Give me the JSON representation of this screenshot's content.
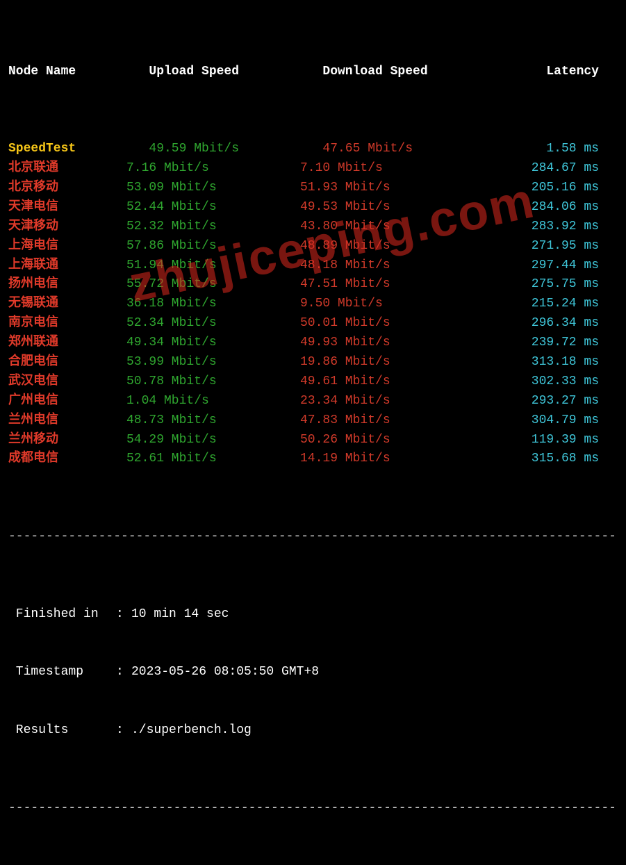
{
  "headers": {
    "node": "Node Name",
    "upload": "Upload Speed",
    "download": "Download Speed",
    "latency": "Latency"
  },
  "rows": [
    {
      "node": "SpeedTest",
      "node_class": "yellow",
      "upload": "49.59 Mbit/s",
      "up_pad": "   ",
      "download": "47.65 Mbit/s",
      "dn_pad": "   ",
      "latency": "1.58 ms",
      "first": true
    },
    {
      "node": "北京联通",
      "node_class": "redb",
      "upload": "7.16 Mbit/s",
      "up_pad": "",
      "download": "7.10 Mbit/s",
      "dn_pad": "",
      "latency": "284.67 ms"
    },
    {
      "node": "北京移动",
      "node_class": "redb",
      "upload": "53.09 Mbit/s",
      "up_pad": "",
      "download": "51.93 Mbit/s",
      "dn_pad": "",
      "latency": "205.16 ms"
    },
    {
      "node": "天津电信",
      "node_class": "redb",
      "upload": "52.44 Mbit/s",
      "up_pad": "",
      "download": "49.53 Mbit/s",
      "dn_pad": "",
      "latency": "284.06 ms"
    },
    {
      "node": "天津移动",
      "node_class": "redb",
      "upload": "52.32 Mbit/s",
      "up_pad": "",
      "download": "43.80 Mbit/s",
      "dn_pad": "",
      "latency": "283.92 ms"
    },
    {
      "node": "上海电信",
      "node_class": "redb",
      "upload": "57.86 Mbit/s",
      "up_pad": "",
      "download": "48.89 Mbit/s",
      "dn_pad": "",
      "latency": "271.95 ms"
    },
    {
      "node": "上海联通",
      "node_class": "redb",
      "upload": "51.94 Mbit/s",
      "up_pad": "",
      "download": "48.18 Mbit/s",
      "dn_pad": "",
      "latency": "297.44 ms"
    },
    {
      "node": "扬州电信",
      "node_class": "redb",
      "upload": "55.72 Mbit/s",
      "up_pad": "",
      "download": "47.51 Mbit/s",
      "dn_pad": "",
      "latency": "275.75 ms"
    },
    {
      "node": "无锡联通",
      "node_class": "redb",
      "upload": "36.18 Mbit/s",
      "up_pad": "",
      "download": "9.50 Mbit/s",
      "dn_pad": "",
      "latency": "215.24 ms"
    },
    {
      "node": "南京电信",
      "node_class": "redb",
      "upload": "52.34 Mbit/s",
      "up_pad": "",
      "download": "50.01 Mbit/s",
      "dn_pad": "",
      "latency": "296.34 ms"
    },
    {
      "node": "郑州联通",
      "node_class": "redb",
      "upload": "49.34 Mbit/s",
      "up_pad": "",
      "download": "49.93 Mbit/s",
      "dn_pad": "",
      "latency": "239.72 ms"
    },
    {
      "node": "合肥电信",
      "node_class": "redb",
      "upload": "53.99 Mbit/s",
      "up_pad": "",
      "download": "19.86 Mbit/s",
      "dn_pad": "",
      "latency": "313.18 ms"
    },
    {
      "node": "武汉电信",
      "node_class": "redb",
      "upload": "50.78 Mbit/s",
      "up_pad": "",
      "download": "49.61 Mbit/s",
      "dn_pad": "",
      "latency": "302.33 ms"
    },
    {
      "node": "广州电信",
      "node_class": "redb",
      "upload": "1.04 Mbit/s",
      "up_pad": "",
      "download": "23.34 Mbit/s",
      "dn_pad": "",
      "latency": "293.27 ms"
    },
    {
      "node": "兰州电信",
      "node_class": "redb",
      "upload": "48.73 Mbit/s",
      "up_pad": "",
      "download": "47.83 Mbit/s",
      "dn_pad": "",
      "latency": "304.79 ms"
    },
    {
      "node": "兰州移动",
      "node_class": "redb",
      "upload": "54.29 Mbit/s",
      "up_pad": "",
      "download": "50.26 Mbit/s",
      "dn_pad": "",
      "latency": "119.39 ms"
    },
    {
      "node": "成都电信",
      "node_class": "redb",
      "upload": "52.61 Mbit/s",
      "up_pad": "",
      "download": "14.19 Mbit/s",
      "dn_pad": "",
      "latency": "315.68 ms"
    }
  ],
  "divider": "----------------------------------------------------------------------------------",
  "footer": {
    "finished_key": " Finished in",
    "finished_val": "10 min 14 sec",
    "timestamp_key": " Timestamp",
    "timestamp_val": "2023-05-26 08:05:50 GMT+8",
    "results_key": " Results",
    "results_val": "./superbench.log",
    "sep": ":"
  },
  "watermark": "zhujiceping.com",
  "chart_data": {
    "type": "table",
    "title": "Network Speed Test Results",
    "columns": [
      "Node Name",
      "Upload Speed (Mbit/s)",
      "Download Speed (Mbit/s)",
      "Latency (ms)"
    ],
    "rows": [
      [
        "SpeedTest",
        49.59,
        47.65,
        1.58
      ],
      [
        "北京联通",
        7.16,
        7.1,
        284.67
      ],
      [
        "北京移动",
        53.09,
        51.93,
        205.16
      ],
      [
        "天津电信",
        52.44,
        49.53,
        284.06
      ],
      [
        "天津移动",
        52.32,
        43.8,
        283.92
      ],
      [
        "上海电信",
        57.86,
        48.89,
        271.95
      ],
      [
        "上海联通",
        51.94,
        48.18,
        297.44
      ],
      [
        "扬州电信",
        55.72,
        47.51,
        275.75
      ],
      [
        "无锡联通",
        36.18,
        9.5,
        215.24
      ],
      [
        "南京电信",
        52.34,
        50.01,
        296.34
      ],
      [
        "郑州联通",
        49.34,
        49.93,
        239.72
      ],
      [
        "合肥电信",
        53.99,
        19.86,
        313.18
      ],
      [
        "武汉电信",
        50.78,
        49.61,
        302.33
      ],
      [
        "广州电信",
        1.04,
        23.34,
        293.27
      ],
      [
        "兰州电信",
        48.73,
        47.83,
        304.79
      ],
      [
        "兰州移动",
        54.29,
        50.26,
        119.39
      ],
      [
        "成都电信",
        52.61,
        14.19,
        315.68
      ]
    ]
  }
}
